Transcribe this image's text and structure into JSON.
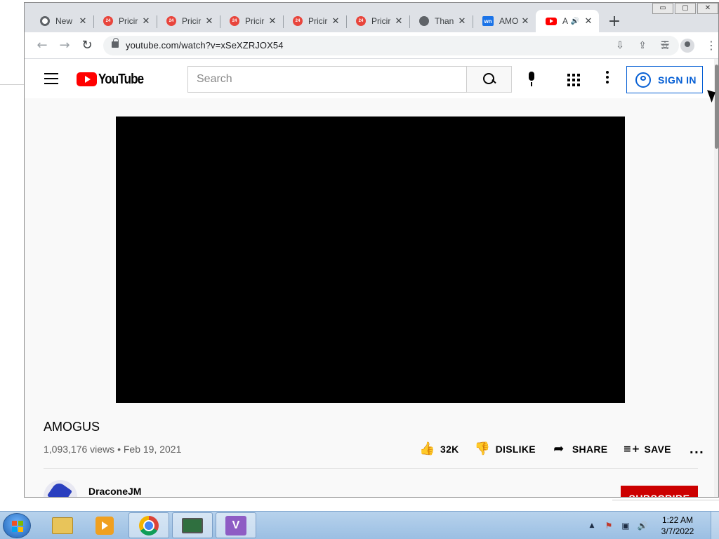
{
  "browser": {
    "tabs": [
      {
        "title": "New",
        "favicon": "chrome-icon",
        "active": false
      },
      {
        "title": "Pricir",
        "favicon": "red-24-icon",
        "active": false
      },
      {
        "title": "Pricir",
        "favicon": "red-24-icon",
        "active": false
      },
      {
        "title": "Pricir",
        "favicon": "red-24-icon",
        "active": false
      },
      {
        "title": "Pricir",
        "favicon": "red-24-icon",
        "active": false
      },
      {
        "title": "Pricir",
        "favicon": "red-24-icon",
        "active": false
      },
      {
        "title": "Than",
        "favicon": "globe-icon",
        "active": false
      },
      {
        "title": "AMO",
        "favicon": "wn-icon",
        "active": false
      },
      {
        "title": "A",
        "favicon": "youtube-icon",
        "active": true
      }
    ],
    "new_tab": "+",
    "wn_badge": "wn",
    "fav_24": "24",
    "url": "youtube.com/watch?v=xSeXZRJOX54",
    "window_controls": {
      "minimize": "▭",
      "maximize": "▢",
      "close": "✕"
    },
    "icons": {
      "back": "←",
      "forward": "→",
      "reload": "↻",
      "install": "⇩",
      "share": "⇪",
      "star": "☆",
      "reading_list": "☰",
      "menu": "⋮",
      "close": "✕",
      "speaker": "🔊"
    }
  },
  "youtube": {
    "logo_text": "YouTube",
    "search_placeholder": "Search",
    "sign_in": "SIGN IN",
    "video_title": "AMOGUS",
    "meta": "1,093,176 views • Feb 19, 2021",
    "actions": {
      "like_count": "32K",
      "dislike": "DISLIKE",
      "share": "SHARE",
      "save": "SAVE",
      "more": "..."
    },
    "action_icons": {
      "like": "👍",
      "dislike": "👎",
      "share": "➦",
      "save": "≡+"
    },
    "channel": "DraconeJM",
    "subscribe": "SUBSCRIBE"
  },
  "taskbar": {
    "time": "1:22 AM",
    "date": "3/7/2022",
    "tray_icons": {
      "arrow": "▲",
      "flag": "⚑",
      "network": "▣",
      "volume": "🔊"
    },
    "vs_glyph": "V"
  }
}
